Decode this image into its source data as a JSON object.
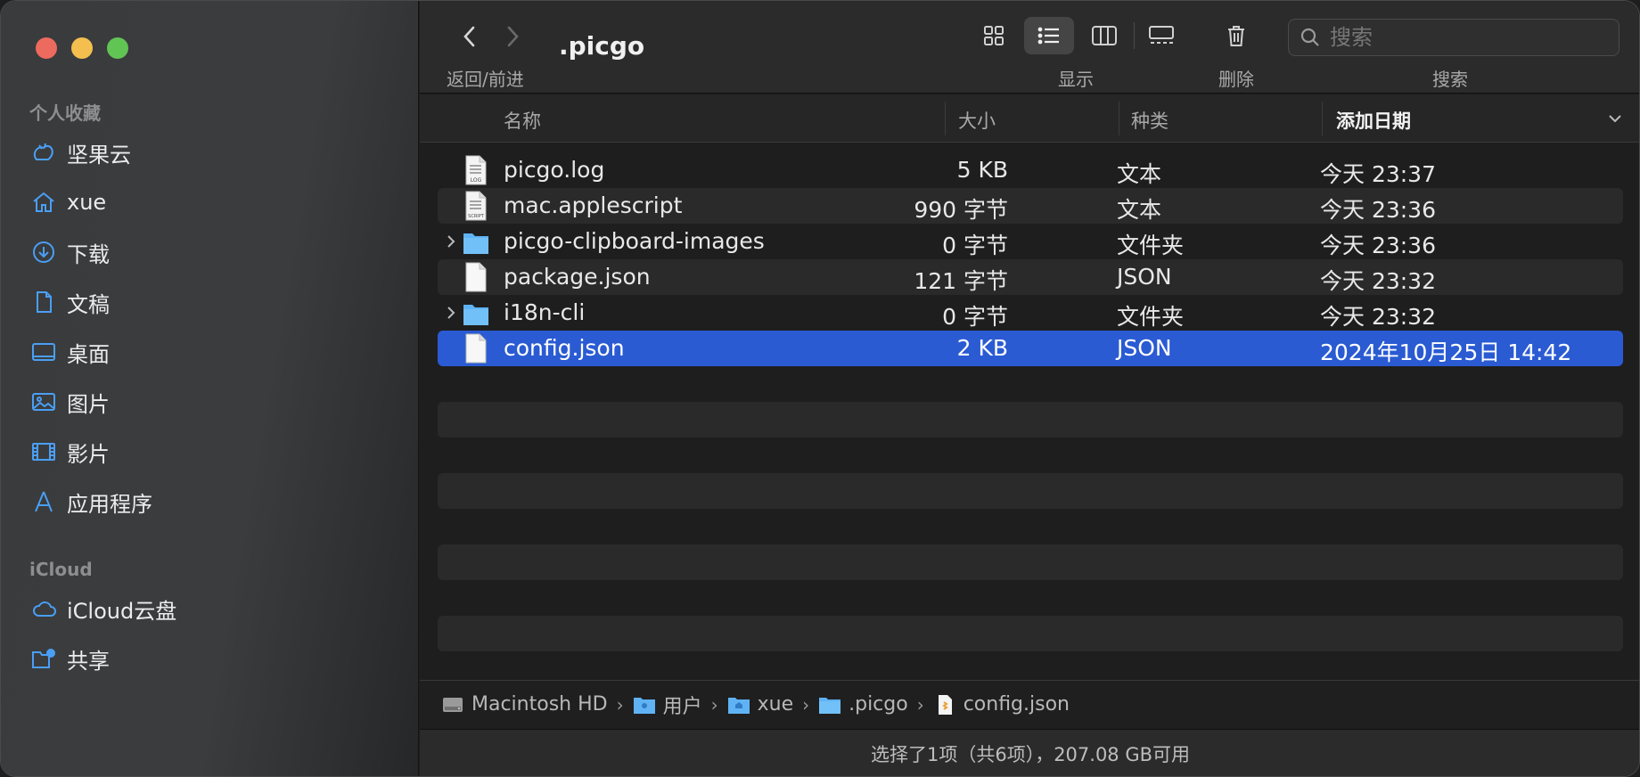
{
  "sidebar": {
    "favorites_title": "个人收藏",
    "favorites": [
      {
        "label": "坚果云",
        "icon": "jianguoyun-icon"
      },
      {
        "label": "xue",
        "icon": "home-icon"
      },
      {
        "label": "下载",
        "icon": "download-icon"
      },
      {
        "label": "文稿",
        "icon": "document-icon"
      },
      {
        "label": "桌面",
        "icon": "desktop-icon"
      },
      {
        "label": "图片",
        "icon": "photo-icon"
      },
      {
        "label": "影片",
        "icon": "film-icon"
      },
      {
        "label": "应用程序",
        "icon": "applications-icon"
      }
    ],
    "icloud_title": "iCloud",
    "icloud": [
      {
        "label": "iCloud云盘",
        "icon": "cloud-icon"
      },
      {
        "label": "共享",
        "icon": "shared-folder-icon"
      }
    ]
  },
  "toolbar": {
    "back_forward_label": "返回/前进",
    "folder_title": ".picgo",
    "view_label": "显示",
    "delete_label": "删除",
    "search_label": "搜索",
    "search_placeholder": "搜索"
  },
  "columns": {
    "name": "名称",
    "size": "大小",
    "kind": "种类",
    "date": "添加日期"
  },
  "files": [
    {
      "name": "picgo.log",
      "size": "5 KB",
      "kind": "文本",
      "date": "今天 23:37",
      "type": "log"
    },
    {
      "name": "mac.applescript",
      "size": "990 字节",
      "kind": "文本",
      "date": "今天 23:36",
      "type": "script"
    },
    {
      "name": "picgo-clipboard-images",
      "size": "0 字节",
      "kind": "文件夹",
      "date": "今天 23:36",
      "type": "folder"
    },
    {
      "name": "package.json",
      "size": "121 字节",
      "kind": "JSON",
      "date": "今天 23:32",
      "type": "file"
    },
    {
      "name": "i18n-cli",
      "size": "0 字节",
      "kind": "文件夹",
      "date": "今天 23:32",
      "type": "folder"
    },
    {
      "name": "config.json",
      "size": "2 KB",
      "kind": "JSON",
      "date": "2024年10月25日 14:42",
      "type": "file",
      "selected": true
    }
  ],
  "pathbar": [
    {
      "label": "Macintosh HD",
      "icon": "disk-icon"
    },
    {
      "label": "用户",
      "icon": "users-folder-icon"
    },
    {
      "label": "xue",
      "icon": "home-folder-icon"
    },
    {
      "label": ".picgo",
      "icon": "folder-icon"
    },
    {
      "label": "config.json",
      "icon": "json-file-icon"
    }
  ],
  "status": "选择了1项（共6项），207.08 GB可用",
  "colors": {
    "selection": "#2a5bd3",
    "sidebar_icon": "#4a9ff5",
    "folder": "#5fb3f5"
  }
}
